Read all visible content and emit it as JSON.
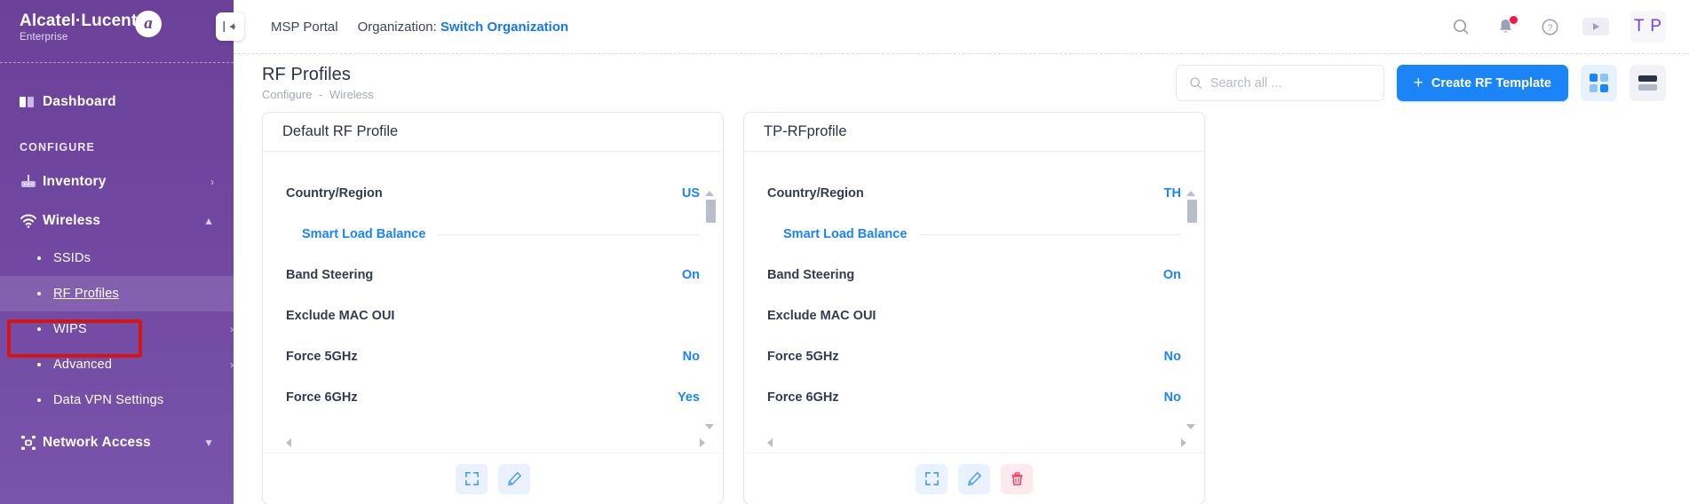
{
  "brand": {
    "name": "Alcatel·Lucent",
    "sub": "Enterprise",
    "logo_glyph": "a"
  },
  "sidebar": {
    "dashboard": {
      "label": "Dashboard",
      "icon": "dashboard-icon"
    },
    "section_label": "CONFIGURE",
    "items": [
      {
        "label": "Inventory",
        "icon": "router-icon",
        "chevron": "›"
      },
      {
        "label": "Wireless",
        "icon": "wifi-icon",
        "chevron": "⌃"
      }
    ],
    "wireless_children": [
      {
        "label": "SSIDs",
        "chevron": ""
      },
      {
        "label": "RF Profiles",
        "chevron": ""
      },
      {
        "label": "WIPS",
        "chevron": "›"
      },
      {
        "label": "Advanced",
        "chevron": "›"
      },
      {
        "label": "Data VPN Settings",
        "chevron": ""
      }
    ],
    "network_access": {
      "label": "Network Access",
      "icon": "network-icon",
      "chevron": "⌄"
    },
    "active_item": "RF Profiles",
    "highlight_color": "#d51414"
  },
  "topbar": {
    "collapse_icon": "collapse-left-icon",
    "msp_portal": "MSP Portal",
    "organization_label": "Organization:",
    "switch_organization": "Switch Organization",
    "icons": [
      "search-icon",
      "bell-icon",
      "help-icon",
      "play-icon"
    ],
    "avatar_initials": "T P"
  },
  "pagehead": {
    "title": "RF Profiles",
    "breadcrumb": [
      "Configure",
      "Wireless"
    ],
    "breadcrumb_separator": "-",
    "search_placeholder": "Search all ...",
    "search_value": "",
    "create_button": "Create RF Template",
    "create_plus": "+",
    "view_grid_icon": "grid-view-icon",
    "view_list_icon": "list-view-icon",
    "accent_color": "#1b84f7"
  },
  "cards": [
    {
      "title": "Default RF Profile",
      "rows": [
        {
          "label": "Country/Region",
          "value": "US"
        },
        {
          "label": "Smart Load Balance",
          "value": "",
          "type": "link"
        },
        {
          "label": "Band Steering",
          "value": "On"
        },
        {
          "label": "Exclude MAC OUI",
          "value": ""
        },
        {
          "label": "Force 5GHz",
          "value": "No"
        },
        {
          "label": "Force 6GHz",
          "value": "Yes"
        }
      ],
      "actions": [
        {
          "name": "expand-icon",
          "label": "Expand"
        },
        {
          "name": "edit-icon",
          "label": "Edit"
        }
      ]
    },
    {
      "title": "TP-RFprofile",
      "rows": [
        {
          "label": "Country/Region",
          "value": "TH"
        },
        {
          "label": "Smart Load Balance",
          "value": "",
          "type": "link"
        },
        {
          "label": "Band Steering",
          "value": "On"
        },
        {
          "label": "Exclude MAC OUI",
          "value": ""
        },
        {
          "label": "Force 5GHz",
          "value": "No"
        },
        {
          "label": "Force 6GHz",
          "value": "No"
        }
      ],
      "actions": [
        {
          "name": "expand-icon",
          "label": "Expand"
        },
        {
          "name": "edit-icon",
          "label": "Edit"
        },
        {
          "name": "delete-icon",
          "label": "Delete"
        }
      ]
    }
  ]
}
